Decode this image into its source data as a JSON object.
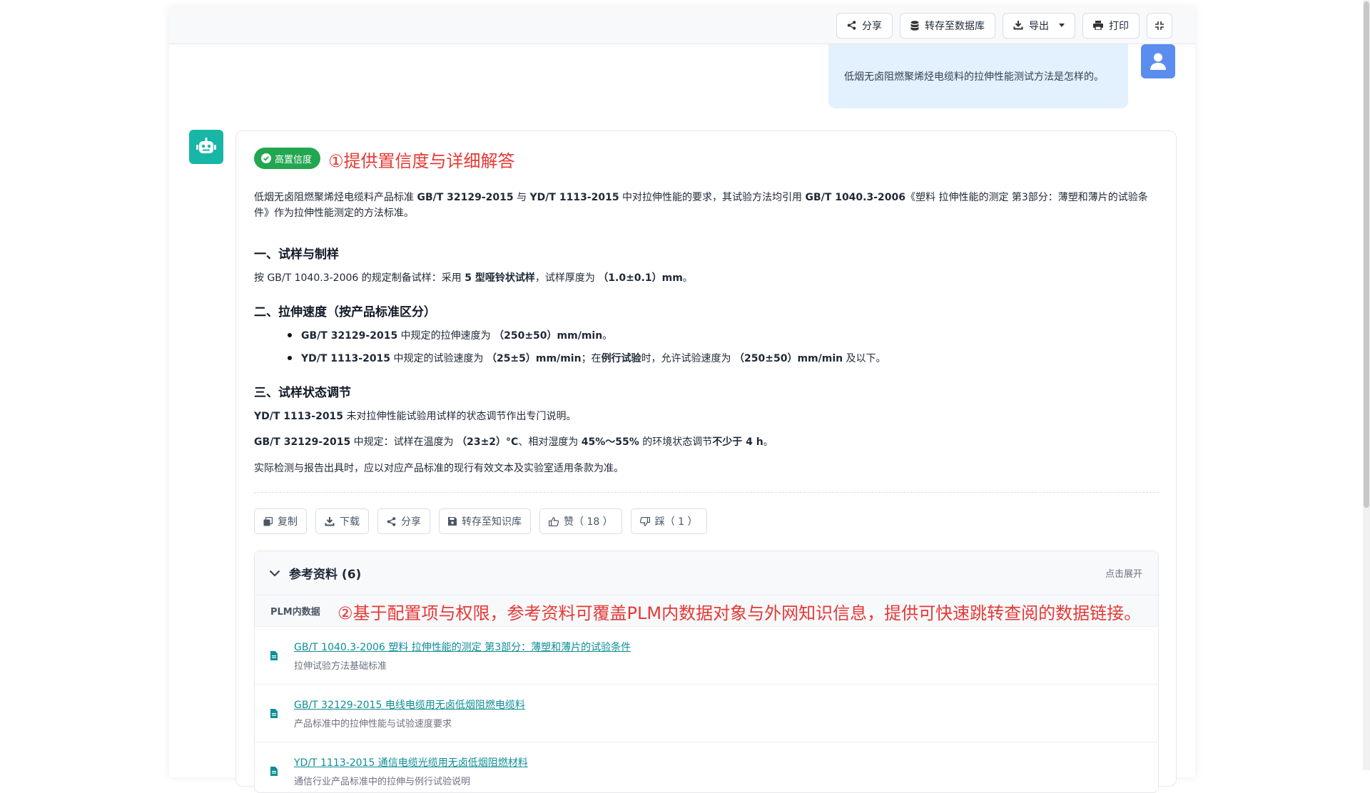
{
  "toolbar": {
    "share_label": "分享",
    "save_db_label": "转存至数据库",
    "export_label": "导出",
    "print_label": "打印"
  },
  "user_message": "低烟无卤阻燃聚烯烃电缆料的拉伸性能测试方法是怎样的。",
  "answer": {
    "badge": "高置信度",
    "annotation_1": "①提供置信度与详细解答",
    "intro_1": "低烟无卤阻燃聚烯烃电缆料产品标准 ",
    "intro_b1": "GB/T 32129-2015",
    "intro_2": " 与 ",
    "intro_b2": "YD/T 1113-2015",
    "intro_3": " 中对拉伸性能的要求，其试验方法均引用 ",
    "intro_b3": "GB/T 1040.3-2006",
    "intro_4": "《塑料 拉伸性能的测定 第3部分：薄塑和薄片的试验条件》作为拉伸性能测定的方法标准。",
    "sec1_title": "一、试样与制样",
    "sec1_text_1": "按 GB/T 1040.3-2006 的规定制备试样：采用 ",
    "sec1_b1": "5 型哑铃状试样",
    "sec1_text_2": "，试样厚度为 ",
    "sec1_b2": "（1.0±0.1）mm",
    "sec1_text_3": "。",
    "sec2_title": "二、拉伸速度（按产品标准区分）",
    "sec2_b1_std": "GB/T 32129-2015",
    "sec2_b1_text": " 中规定的拉伸速度为 ",
    "sec2_b1_val": "（250±50）mm/min",
    "sec2_b1_end": "。",
    "sec2_b2_std": "YD/T 1113-2015",
    "sec2_b2_text": " 中规定的试验速度为 ",
    "sec2_b2_val": "（25±5）mm/min",
    "sec2_b2_text2": "；在",
    "sec2_b2_b2": "例行试验",
    "sec2_b2_text3": "时，允许试验速度为 ",
    "sec2_b2_val2": "（250±50）mm/min",
    "sec2_b2_end": " 及以下。",
    "sec3_title": "三、试样状态调节",
    "sec3_p1_b": "YD/T 1113-2015",
    "sec3_p1_text": " 未对拉伸性能试验用试样的状态调节作出专门说明。",
    "sec3_p2_b": "GB/T 32129-2015",
    "sec3_p2_text1": " 中规定：试样在温度为 ",
    "sec3_p2_b2": "（23±2）°C",
    "sec3_p2_text2": "、相对湿度为 ",
    "sec3_p2_b3": "45%～55%",
    "sec3_p2_text3": " 的环境状态调节",
    "sec3_p2_b4": "不少于 4 h",
    "sec3_p2_text4": "。",
    "note": "实际检测与报告出具时，应以对应产品标准的现行有效文本及实验室适用条款为准。"
  },
  "actions": {
    "copy": "复制",
    "download": "下载",
    "share": "分享",
    "save_kb": "转存至知识库",
    "like": "赞（ 18 ）",
    "dislike": "踩（ 1 ）"
  },
  "references": {
    "title": "参考资料 (6)",
    "expand": "点击展开",
    "group_label": "PLM内数据",
    "annotation_2": "②基于配置项与权限，参考资料可覆盖PLM内数据对象与外网知识信息，提供可快速跳转查阅的数据链接。",
    "items": [
      {
        "title": "GB/T 1040.3-2006 塑料 拉伸性能的测定 第3部分：薄塑和薄片的试验条件",
        "desc": "拉伸试验方法基础标准"
      },
      {
        "title": "GB/T 32129-2015 电线电缆用无卤低烟阻燃电缆料",
        "desc": "产品标准中的拉伸性能与试验速度要求"
      },
      {
        "title": "YD/T 1113-2015 通信电缆光缆用无卤低烟阻燃材料",
        "desc": "通信行业产品标准中的拉伸与例行试验说明"
      }
    ]
  },
  "colors": {
    "accent_teal": "#17b6a6",
    "user_blue": "#5b8def",
    "badge_green": "#22a650",
    "annotation_red": "#e53935",
    "link_teal": "#0f8f96"
  }
}
